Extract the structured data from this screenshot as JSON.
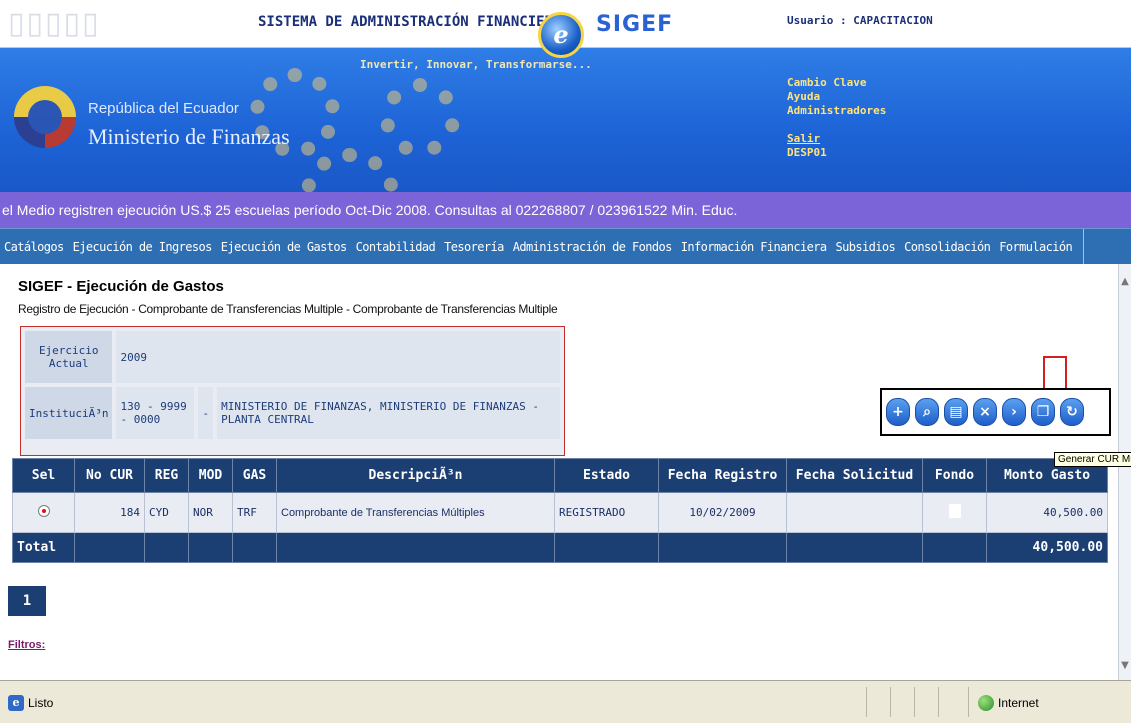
{
  "header": {
    "system_title": "SISTEMA DE ADMINISTRACIÓN FINANCIERA",
    "sigef_logo": "SIGEF",
    "user_label": "Usuario : CAPACITACION",
    "slogan": "Invertir, Innovar, Transformarse...",
    "country": "República del Ecuador",
    "ministry": "Ministerio de Finanzas",
    "links": {
      "cambio_clave": "Cambio Clave",
      "ayuda": "Ayuda",
      "administradores": "Administradores",
      "salir": "Salir"
    },
    "server": "DESP01"
  },
  "marquee": "el Medio registren ejecución US.$ 25 escuelas período Oct-Dic 2008. Consultas al 022268807 / 023961522 Min. Educ.",
  "menu": [
    "Catálogos",
    "Ejecución de Ingresos",
    "Ejecución de Gastos",
    "Contabilidad",
    "Tesorería",
    "Administración de Fondos",
    "Información Financiera",
    "Subsidios",
    "Consolidación",
    "Formulación"
  ],
  "page": {
    "title": "SIGEF - Ejecución de Gastos",
    "breadcrumb": "Registro de Ejecución - Comprobante de Transferencias Multiple - Comprobante de Transferencias Multiple"
  },
  "info": {
    "ejercicio_label": "Ejercicio Actual",
    "ejercicio_value": "2009",
    "institucion_label": "InstituciÃ³n",
    "institucion_code": "130 - 9999 - 0000",
    "institucion_sep": "-",
    "institucion_name": "MINISTERIO DE FINANZAS, MINISTERIO DE FINANZAS - PLANTA CENTRAL"
  },
  "toolbar": {
    "buttons": [
      "add-doc-icon",
      "search-doc-icon",
      "print-icon",
      "delete-doc-icon",
      "forward-doc-icon",
      "copy-doc-icon",
      "refresh-icon"
    ],
    "tooltip": "Generar CUR Mu"
  },
  "grid": {
    "columns": [
      "Sel",
      "No CUR",
      "REG",
      "MOD",
      "GAS",
      "DescripciÃ³n",
      "Estado",
      "Fecha Registro",
      "Fecha Solicitud",
      "Fondo",
      "Monto Gasto"
    ],
    "rows": [
      {
        "no_cur": "184",
        "reg": "CYD",
        "mod": "NOR",
        "gas": "TRF",
        "descripcion": "Comprobante de Transferencias Múltiples",
        "estado": "REGISTRADO",
        "fecha_registro": "10/02/2009",
        "fecha_solicitud": "",
        "monto": "40,500.00"
      }
    ],
    "total_label": "Total",
    "total_value": "40,500.00"
  },
  "pager": {
    "page": "1"
  },
  "filtros": "Filtros:",
  "statusbar": {
    "text": "Listo",
    "zone": "Internet"
  },
  "colors": {
    "header_blue": "#1d63d6",
    "menu_blue": "#2e6fb3",
    "marquee_purple": "#7b63d8",
    "grid_header": "#1c3f73",
    "highlight_red": "#cc1f1f"
  }
}
